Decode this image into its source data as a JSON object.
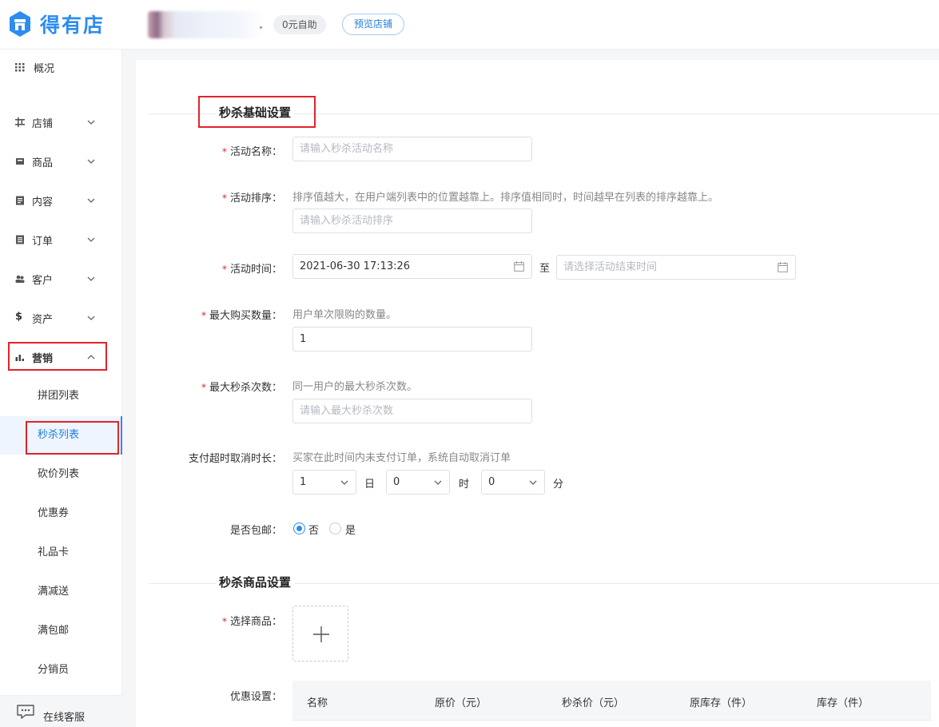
{
  "header": {
    "brand": "得有店",
    "badge_self": "0元自助",
    "preview_button": "预览店铺"
  },
  "sidebar": {
    "overview": "概况",
    "items": [
      {
        "label": "店铺",
        "icon": "store-icon"
      },
      {
        "label": "商品",
        "icon": "goods-icon"
      },
      {
        "label": "内容",
        "icon": "content-icon"
      },
      {
        "label": "订单",
        "icon": "order-icon"
      },
      {
        "label": "客户",
        "icon": "customer-icon"
      },
      {
        "label": "资产",
        "icon": "dollar-icon"
      },
      {
        "label": "营销",
        "icon": "chart-icon"
      }
    ],
    "marketing_sub": [
      "拼团列表",
      "秒杀列表",
      "砍价列表",
      "优惠券",
      "礼品卡",
      "满减送",
      "满包邮",
      "分销员"
    ],
    "online_service": "在线客服"
  },
  "form": {
    "section_basic": "秒杀基础设置",
    "activity_name": {
      "label": "活动名称：",
      "placeholder": "请输入秒杀活动名称"
    },
    "activity_sort": {
      "label": "活动排序：",
      "hint": "排序值越大，在用户端列表中的位置越靠上。排序值相同时，时间越早在列表的排序越靠上。",
      "placeholder": "请输入秒杀活动排序"
    },
    "activity_time": {
      "label": "活动时间：",
      "start_value": "2021-06-30 17:13:26",
      "separator": "至",
      "end_placeholder": "请选择活动结束时间"
    },
    "max_buy": {
      "label": "最大购买数量：",
      "hint": "用户单次限购的数量。",
      "value": "1"
    },
    "max_seckill": {
      "label": "最大秒杀次数：",
      "hint": "同一用户的最大秒杀次数。",
      "placeholder": "请输入最大秒杀次数"
    },
    "timeout": {
      "label": "支付超时取消时长：",
      "hint": "买家在此时间内未支付订单，系统自动取消订单",
      "day_value": "1",
      "day_unit": "日",
      "hour_value": "0",
      "hour_unit": "时",
      "minute_value": "0",
      "minute_unit": "分"
    },
    "free_shipping": {
      "label": "是否包邮：",
      "option_no": "否",
      "option_yes": "是"
    },
    "section_goods": "秒杀商品设置",
    "select_goods": {
      "label": "选择商品："
    },
    "discount": {
      "label": "优惠设置："
    },
    "table_headers": [
      "名称",
      "原价（元）",
      "秒杀价（元）",
      "原库存（件）",
      "库存（件）"
    ]
  },
  "colors": {
    "accent": "#2d8cf0",
    "highlight_box": "#e0242b",
    "required": "#e0242b"
  }
}
